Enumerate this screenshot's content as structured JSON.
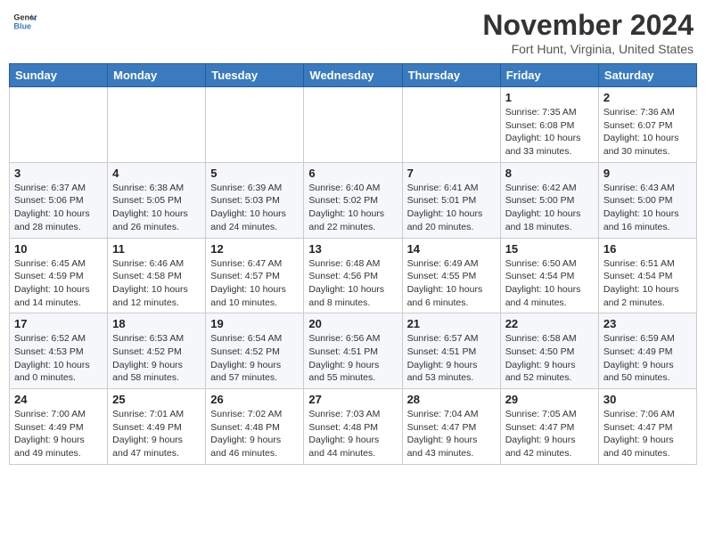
{
  "header": {
    "logo_line1": "General",
    "logo_line2": "Blue",
    "month": "November 2024",
    "location": "Fort Hunt, Virginia, United States"
  },
  "weekdays": [
    "Sunday",
    "Monday",
    "Tuesday",
    "Wednesday",
    "Thursday",
    "Friday",
    "Saturday"
  ],
  "weeks": [
    [
      {
        "day": "",
        "info": ""
      },
      {
        "day": "",
        "info": ""
      },
      {
        "day": "",
        "info": ""
      },
      {
        "day": "",
        "info": ""
      },
      {
        "day": "",
        "info": ""
      },
      {
        "day": "1",
        "info": "Sunrise: 7:35 AM\nSunset: 6:08 PM\nDaylight: 10 hours\nand 33 minutes."
      },
      {
        "day": "2",
        "info": "Sunrise: 7:36 AM\nSunset: 6:07 PM\nDaylight: 10 hours\nand 30 minutes."
      }
    ],
    [
      {
        "day": "3",
        "info": "Sunrise: 6:37 AM\nSunset: 5:06 PM\nDaylight: 10 hours\nand 28 minutes."
      },
      {
        "day": "4",
        "info": "Sunrise: 6:38 AM\nSunset: 5:05 PM\nDaylight: 10 hours\nand 26 minutes."
      },
      {
        "day": "5",
        "info": "Sunrise: 6:39 AM\nSunset: 5:03 PM\nDaylight: 10 hours\nand 24 minutes."
      },
      {
        "day": "6",
        "info": "Sunrise: 6:40 AM\nSunset: 5:02 PM\nDaylight: 10 hours\nand 22 minutes."
      },
      {
        "day": "7",
        "info": "Sunrise: 6:41 AM\nSunset: 5:01 PM\nDaylight: 10 hours\nand 20 minutes."
      },
      {
        "day": "8",
        "info": "Sunrise: 6:42 AM\nSunset: 5:00 PM\nDaylight: 10 hours\nand 18 minutes."
      },
      {
        "day": "9",
        "info": "Sunrise: 6:43 AM\nSunset: 5:00 PM\nDaylight: 10 hours\nand 16 minutes."
      }
    ],
    [
      {
        "day": "10",
        "info": "Sunrise: 6:45 AM\nSunset: 4:59 PM\nDaylight: 10 hours\nand 14 minutes."
      },
      {
        "day": "11",
        "info": "Sunrise: 6:46 AM\nSunset: 4:58 PM\nDaylight: 10 hours\nand 12 minutes."
      },
      {
        "day": "12",
        "info": "Sunrise: 6:47 AM\nSunset: 4:57 PM\nDaylight: 10 hours\nand 10 minutes."
      },
      {
        "day": "13",
        "info": "Sunrise: 6:48 AM\nSunset: 4:56 PM\nDaylight: 10 hours\nand 8 minutes."
      },
      {
        "day": "14",
        "info": "Sunrise: 6:49 AM\nSunset: 4:55 PM\nDaylight: 10 hours\nand 6 minutes."
      },
      {
        "day": "15",
        "info": "Sunrise: 6:50 AM\nSunset: 4:54 PM\nDaylight: 10 hours\nand 4 minutes."
      },
      {
        "day": "16",
        "info": "Sunrise: 6:51 AM\nSunset: 4:54 PM\nDaylight: 10 hours\nand 2 minutes."
      }
    ],
    [
      {
        "day": "17",
        "info": "Sunrise: 6:52 AM\nSunset: 4:53 PM\nDaylight: 10 hours\nand 0 minutes."
      },
      {
        "day": "18",
        "info": "Sunrise: 6:53 AM\nSunset: 4:52 PM\nDaylight: 9 hours\nand 58 minutes."
      },
      {
        "day": "19",
        "info": "Sunrise: 6:54 AM\nSunset: 4:52 PM\nDaylight: 9 hours\nand 57 minutes."
      },
      {
        "day": "20",
        "info": "Sunrise: 6:56 AM\nSunset: 4:51 PM\nDaylight: 9 hours\nand 55 minutes."
      },
      {
        "day": "21",
        "info": "Sunrise: 6:57 AM\nSunset: 4:51 PM\nDaylight: 9 hours\nand 53 minutes."
      },
      {
        "day": "22",
        "info": "Sunrise: 6:58 AM\nSunset: 4:50 PM\nDaylight: 9 hours\nand 52 minutes."
      },
      {
        "day": "23",
        "info": "Sunrise: 6:59 AM\nSunset: 4:49 PM\nDaylight: 9 hours\nand 50 minutes."
      }
    ],
    [
      {
        "day": "24",
        "info": "Sunrise: 7:00 AM\nSunset: 4:49 PM\nDaylight: 9 hours\nand 49 minutes."
      },
      {
        "day": "25",
        "info": "Sunrise: 7:01 AM\nSunset: 4:49 PM\nDaylight: 9 hours\nand 47 minutes."
      },
      {
        "day": "26",
        "info": "Sunrise: 7:02 AM\nSunset: 4:48 PM\nDaylight: 9 hours\nand 46 minutes."
      },
      {
        "day": "27",
        "info": "Sunrise: 7:03 AM\nSunset: 4:48 PM\nDaylight: 9 hours\nand 44 minutes."
      },
      {
        "day": "28",
        "info": "Sunrise: 7:04 AM\nSunset: 4:47 PM\nDaylight: 9 hours\nand 43 minutes."
      },
      {
        "day": "29",
        "info": "Sunrise: 7:05 AM\nSunset: 4:47 PM\nDaylight: 9 hours\nand 42 minutes."
      },
      {
        "day": "30",
        "info": "Sunrise: 7:06 AM\nSunset: 4:47 PM\nDaylight: 9 hours\nand 40 minutes."
      }
    ]
  ]
}
